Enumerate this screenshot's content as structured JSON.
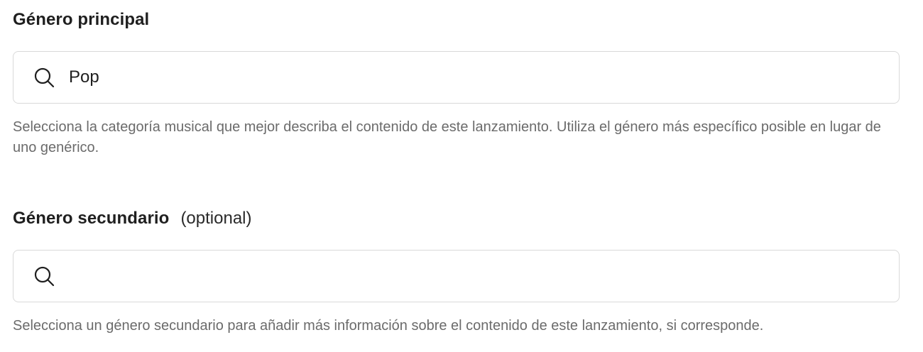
{
  "primary_genre": {
    "label": "Género principal",
    "value": "Pop",
    "helper": "Selecciona la categoría musical que mejor describa el contenido de este lanzamiento. Utiliza el género más específico posible en lugar de uno genérico."
  },
  "secondary_genre": {
    "label": "Género secundario",
    "optional": "(optional)",
    "value": "",
    "helper": "Selecciona un género secundario para añadir más información sobre el contenido de este lanzamiento, si corresponde."
  },
  "icons": {
    "search": "search-icon"
  },
  "colors": {
    "label": "#1f1f1f",
    "helper": "#6b6b6b",
    "border": "#d9d9d9"
  }
}
